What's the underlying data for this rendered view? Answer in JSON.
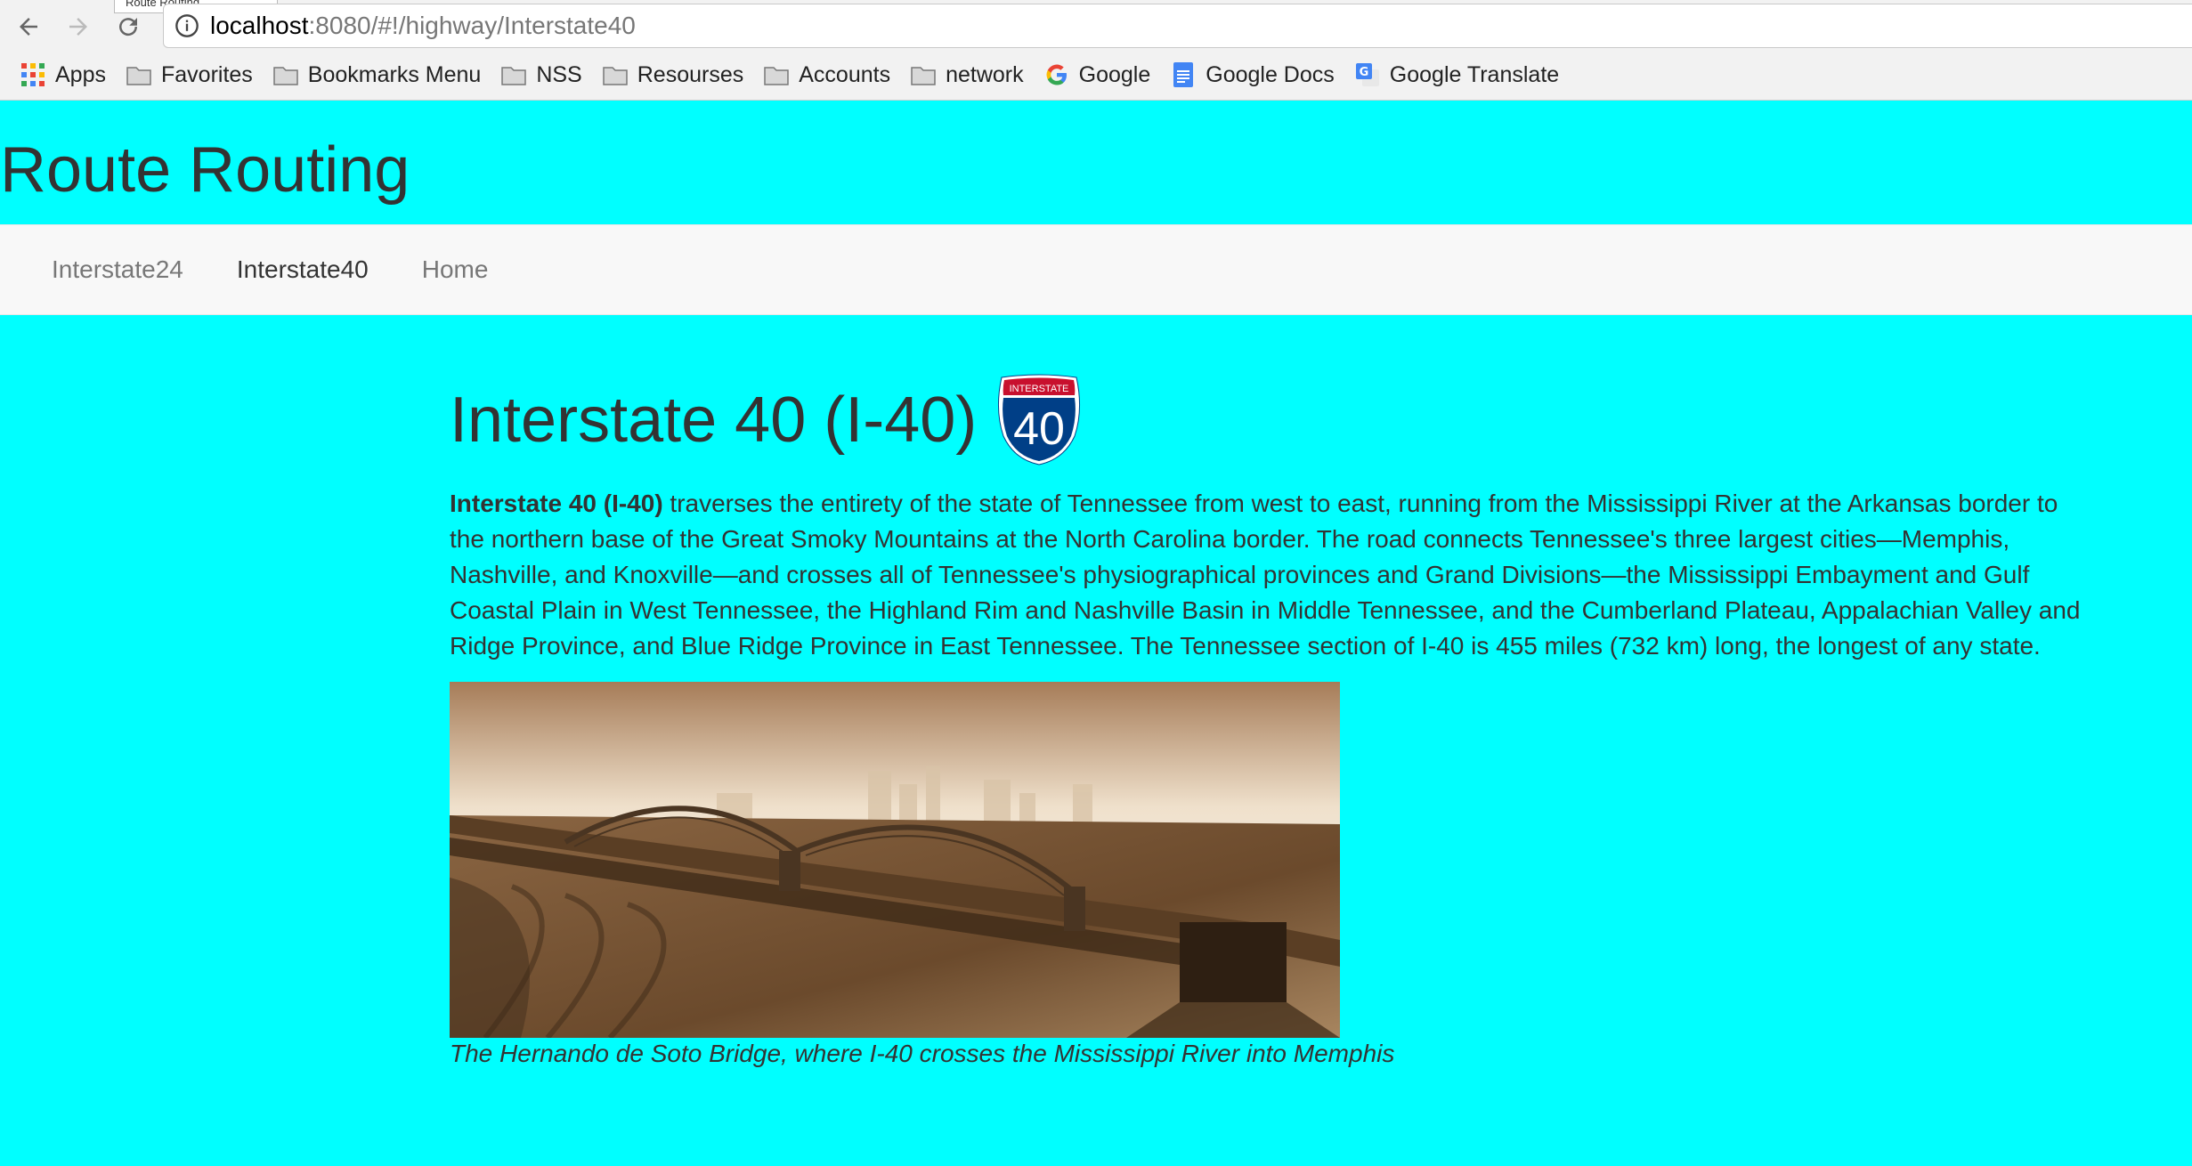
{
  "browser": {
    "tab_tooltip": "Route Routing",
    "url_host": "localhost",
    "url_rest": ":8080/#!/highway/Interstate40",
    "bookmarks": [
      {
        "label": "Apps",
        "icon": "apps-grid-icon"
      },
      {
        "label": "Favorites",
        "icon": "folder-icon"
      },
      {
        "label": "Bookmarks Menu",
        "icon": "folder-icon"
      },
      {
        "label": "NSS",
        "icon": "folder-icon"
      },
      {
        "label": "Resourses",
        "icon": "folder-icon"
      },
      {
        "label": "Accounts",
        "icon": "folder-icon"
      },
      {
        "label": "network",
        "icon": "folder-icon"
      },
      {
        "label": "Google",
        "icon": "google-g-icon"
      },
      {
        "label": "Google Docs",
        "icon": "google-docs-icon"
      },
      {
        "label": "Google Translate",
        "icon": "google-translate-icon"
      }
    ]
  },
  "site": {
    "title": "Route Routing",
    "nav": [
      {
        "label": "Interstate24",
        "active": false
      },
      {
        "label": "Interstate40",
        "active": true
      },
      {
        "label": "Home",
        "active": false
      }
    ]
  },
  "article": {
    "heading": "Interstate 40 (I-40)",
    "shield": {
      "top_text": "INTERSTATE",
      "number": "40"
    },
    "lead_bold": "Interstate 40 (I-40)",
    "body": " traverses the entirety of the state of Tennessee from west to east, running from the Mississippi River at the Arkansas border to the northern base of the Great Smoky Mountains at the North Carolina border. The road connects Tennessee's three largest cities—Memphis, Nashville, and Knoxville—and crosses all of Tennessee's physiographical provinces and Grand Divisions—the Mississippi Embayment and Gulf Coastal Plain in West Tennessee, the Highland Rim and Nashville Basin in Middle Tennessee, and the Cumberland Plateau, Appalachian Valley and Ridge Province, and Blue Ridge Province in East Tennessee. The Tennessee section of I-40 is 455 miles (732 km) long, the longest of any state.",
    "caption": "The Hernando de Soto Bridge, where I-40 crosses the Mississippi River into Memphis"
  },
  "colors": {
    "page_background": "#00ffff",
    "navbar_background": "#f8f8f8",
    "shield_blue": "#003f87",
    "shield_red": "#c8102e"
  }
}
